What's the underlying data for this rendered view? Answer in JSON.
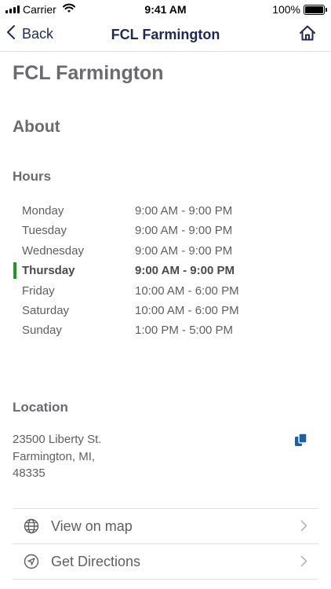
{
  "status_bar": {
    "carrier": "Carrier",
    "time": "9:41 AM",
    "battery": "100%"
  },
  "nav": {
    "back_label": "Back",
    "title": "FCL Farmington"
  },
  "page_title": "FCL Farmington",
  "about_heading": "About",
  "hours_heading": "Hours",
  "hours": [
    {
      "day": "Monday",
      "time": "9:00 AM - 9:00 PM"
    },
    {
      "day": "Tuesday",
      "time": "9:00 AM - 9:00 PM"
    },
    {
      "day": "Wednesday",
      "time": "9:00 AM - 9:00 PM"
    },
    {
      "day": "Thursday",
      "time": "9:00 AM - 9:00 PM"
    },
    {
      "day": "Friday",
      "time": "10:00 AM - 6:00 PM"
    },
    {
      "day": "Saturday",
      "time": "10:00 AM - 6:00 PM"
    },
    {
      "day": "Sunday",
      "time": "1:00 PM - 5:00 PM"
    }
  ],
  "today_index": 3,
  "location_heading": "Location",
  "address": {
    "line1": "23500 Liberty St.",
    "line2": "Farmington, MI,",
    "line3": "48335"
  },
  "actions": [
    {
      "label": "View on map",
      "icon": "globe-icon"
    },
    {
      "label": "Get Directions",
      "icon": "navigation-arrow-icon"
    }
  ],
  "colors": {
    "accent": "#1e2a55",
    "today_marker": "#1e9a1e",
    "copy_icon": "#1f5fa3"
  }
}
